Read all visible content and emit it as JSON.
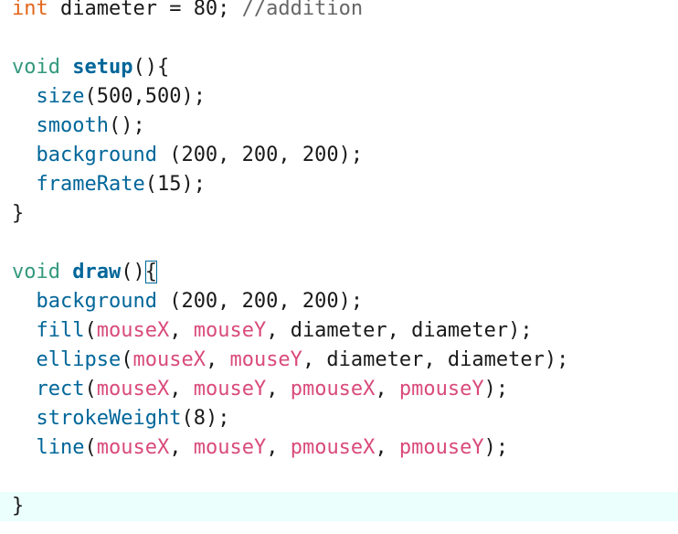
{
  "code": {
    "lines": [
      [
        {
          "t": "int",
          "c": "type"
        },
        {
          "t": " diameter = 80; ",
          "c": "plain"
        },
        {
          "t": "//addition",
          "c": "cmt"
        }
      ],
      [],
      [
        {
          "t": "void",
          "c": "kw"
        },
        {
          "t": " ",
          "c": "plain"
        },
        {
          "t": "setup",
          "c": "fn-def"
        },
        {
          "t": "(){",
          "c": "plain"
        }
      ],
      [
        {
          "t": "  ",
          "c": "plain"
        },
        {
          "t": "size",
          "c": "fn"
        },
        {
          "t": "(500,500);",
          "c": "plain"
        }
      ],
      [
        {
          "t": "  ",
          "c": "plain"
        },
        {
          "t": "smooth",
          "c": "fn"
        },
        {
          "t": "();",
          "c": "plain"
        }
      ],
      [
        {
          "t": "  ",
          "c": "plain"
        },
        {
          "t": "background",
          "c": "fn"
        },
        {
          "t": " (200, 200, 200);",
          "c": "plain"
        }
      ],
      [
        {
          "t": "  ",
          "c": "plain"
        },
        {
          "t": "frameRate",
          "c": "fn"
        },
        {
          "t": "(15);",
          "c": "plain"
        }
      ],
      [
        {
          "t": "}",
          "c": "plain"
        }
      ],
      [],
      [
        {
          "t": "void",
          "c": "kw"
        },
        {
          "t": " ",
          "c": "plain"
        },
        {
          "t": "draw",
          "c": "fn-def"
        },
        {
          "t": "()",
          "c": "plain"
        },
        {
          "t": "{",
          "c": "plain",
          "match": true
        }
      ],
      [
        {
          "t": "  ",
          "c": "plain"
        },
        {
          "t": "background",
          "c": "fn"
        },
        {
          "t": " (200, 200, 200);",
          "c": "plain"
        }
      ],
      [
        {
          "t": "  ",
          "c": "plain"
        },
        {
          "t": "fill",
          "c": "fn"
        },
        {
          "t": "(",
          "c": "plain"
        },
        {
          "t": "mouseX",
          "c": "var"
        },
        {
          "t": ", ",
          "c": "plain"
        },
        {
          "t": "mouseY",
          "c": "var"
        },
        {
          "t": ", diameter, diameter);",
          "c": "plain"
        }
      ],
      [
        {
          "t": "  ",
          "c": "plain"
        },
        {
          "t": "ellipse",
          "c": "fn"
        },
        {
          "t": "(",
          "c": "plain"
        },
        {
          "t": "mouseX",
          "c": "var"
        },
        {
          "t": ", ",
          "c": "plain"
        },
        {
          "t": "mouseY",
          "c": "var"
        },
        {
          "t": ", diameter, diameter);",
          "c": "plain"
        }
      ],
      [
        {
          "t": "  ",
          "c": "plain"
        },
        {
          "t": "rect",
          "c": "fn"
        },
        {
          "t": "(",
          "c": "plain"
        },
        {
          "t": "mouseX",
          "c": "var"
        },
        {
          "t": ", ",
          "c": "plain"
        },
        {
          "t": "mouseY",
          "c": "var"
        },
        {
          "t": ", ",
          "c": "plain"
        },
        {
          "t": "pmouseX",
          "c": "var"
        },
        {
          "t": ", ",
          "c": "plain"
        },
        {
          "t": "pmouseY",
          "c": "var"
        },
        {
          "t": ");",
          "c": "plain"
        }
      ],
      [
        {
          "t": "  ",
          "c": "plain"
        },
        {
          "t": "strokeWeight",
          "c": "fn"
        },
        {
          "t": "(8);",
          "c": "plain"
        }
      ],
      [
        {
          "t": "  ",
          "c": "plain"
        },
        {
          "t": "line",
          "c": "fn"
        },
        {
          "t": "(",
          "c": "plain"
        },
        {
          "t": "mouseX",
          "c": "var"
        },
        {
          "t": ", ",
          "c": "plain"
        },
        {
          "t": "mouseY",
          "c": "var"
        },
        {
          "t": ", ",
          "c": "plain"
        },
        {
          "t": "pmouseX",
          "c": "var"
        },
        {
          "t": ", ",
          "c": "plain"
        },
        {
          "t": "pmouseY",
          "c": "var"
        },
        {
          "t": ");",
          "c": "plain"
        }
      ],
      [],
      [
        {
          "t": "}",
          "c": "plain"
        }
      ]
    ],
    "current_line_index": 17
  },
  "colors": {
    "type": "#e2661a",
    "keyword": "#33997e",
    "function": "#006699",
    "variable": "#d94a7a",
    "comment": "#666666",
    "text": "#1a1a1a",
    "current_line_bg": "#ebfffd"
  }
}
